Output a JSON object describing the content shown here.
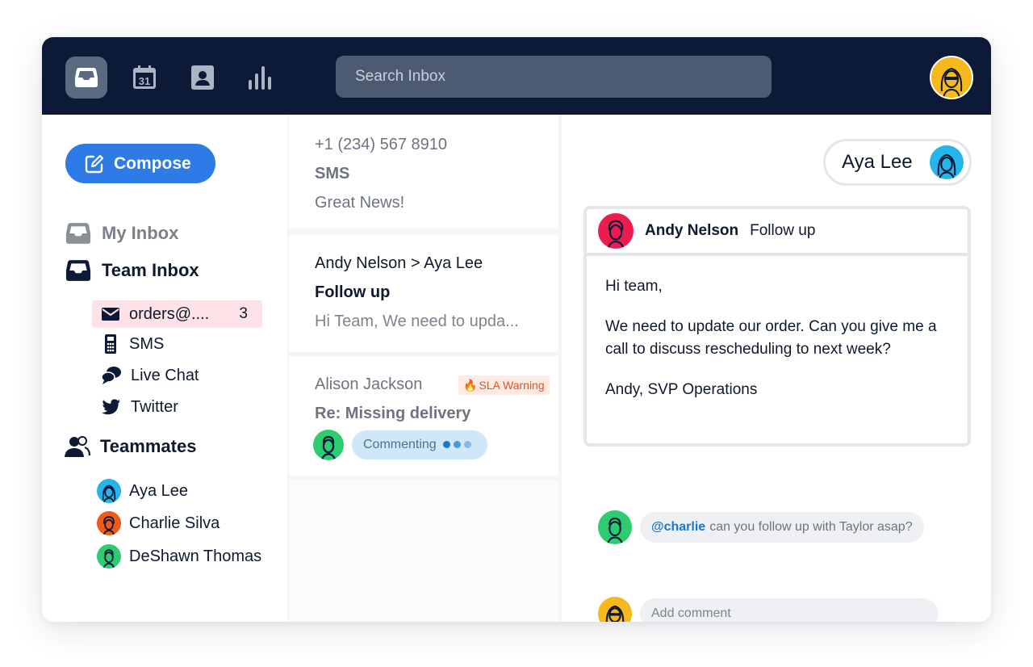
{
  "colors": {
    "topbar": "#0c1a37",
    "accent": "#2e7ae6",
    "selected_row": "#fde3e8",
    "sla_text": "#e2521c",
    "avatar_yellow": "#f6b81d",
    "avatar_blue": "#25b5ea",
    "avatar_orange": "#ef5a19",
    "avatar_green": "#2ecc71",
    "avatar_red": "#ee1c4e"
  },
  "topbar": {
    "nav": [
      {
        "name": "inbox-nav",
        "icon": "inbox-tray-icon",
        "active": true
      },
      {
        "name": "calendar-nav",
        "icon": "calendar-icon",
        "label": "31"
      },
      {
        "name": "contacts-nav",
        "icon": "contact-card-icon"
      },
      {
        "name": "analytics-nav",
        "icon": "bar-chart-icon"
      }
    ],
    "search_placeholder": "Search Inbox",
    "user_avatar": "user-avatar-yellow"
  },
  "sidebar": {
    "compose_label": "Compose",
    "my_inbox": "My Inbox",
    "team_inbox": "Team Inbox",
    "channels": [
      {
        "label": "orders@....",
        "count": "3",
        "icon": "envelope-icon",
        "selected": true
      },
      {
        "label": "SMS",
        "icon": "phone-icon"
      },
      {
        "label": "Live Chat",
        "icon": "chat-bubbles-icon"
      },
      {
        "label": "Twitter",
        "icon": "twitter-bird-icon"
      }
    ],
    "teammates_heading": "Teammates",
    "teammates": [
      {
        "name": "Aya Lee",
        "color": "#25b5ea"
      },
      {
        "name": "Charlie Silva",
        "color": "#ef5a19"
      },
      {
        "name": "DeShawn Thomas",
        "color": "#2ecc71"
      }
    ]
  },
  "list": {
    "items": [
      {
        "from": "+1 (234) 567 8910",
        "subject": "SMS",
        "preview": "Great News!"
      },
      {
        "from": "Andy Nelson > Aya Lee",
        "subject": "Follow up",
        "preview": "Hi Team, We need to upda..."
      },
      {
        "from": "Alison Jackson",
        "subject": "Re: Missing delivery",
        "badge": "SLA Warning",
        "status": "Commenting"
      }
    ]
  },
  "conversation": {
    "assignee": "Aya Lee",
    "message": {
      "from": "Andy Nelson",
      "subject": "Follow up",
      "greeting": "Hi team,",
      "body": "We need to update our order. Can you give me a call to discuss rescheduling to next week?",
      "signature": "Andy, SVP Operations"
    },
    "comment": {
      "mention": "@charlie",
      "text": "can you follow up with Taylor asap?"
    },
    "add_comment_placeholder": "Add comment"
  }
}
